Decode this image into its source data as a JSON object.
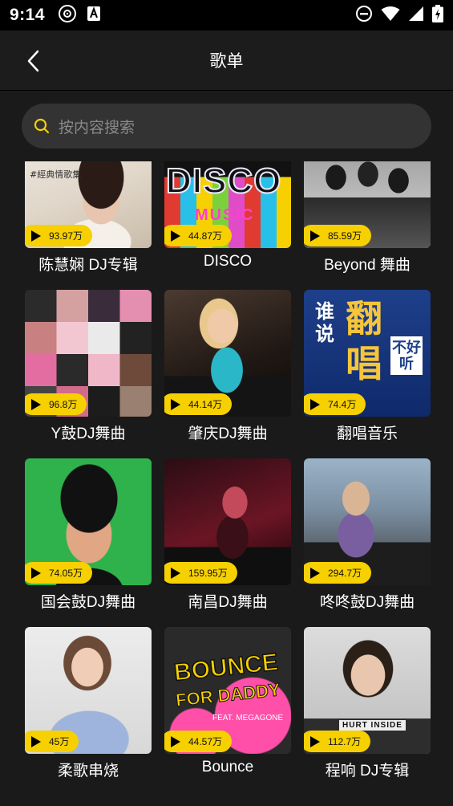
{
  "status_bar": {
    "time": "9:14"
  },
  "header": {
    "title": "歌单"
  },
  "search": {
    "placeholder": "按内容搜索"
  },
  "playlists": [
    {
      "name": "陈慧娴 DJ专辑",
      "plays": "93.97万",
      "art_text": "#經典情歌集"
    },
    {
      "name": "DISCO",
      "plays": "44.87万",
      "art_text": "DISCO",
      "art_text2": "MUSIC"
    },
    {
      "name": "Beyond 舞曲",
      "plays": "85.59万"
    },
    {
      "name": "Y鼓DJ舞曲",
      "plays": "96.8万"
    },
    {
      "name": "肇庆DJ舞曲",
      "plays": "44.14万"
    },
    {
      "name": "翻唱音乐",
      "plays": "74.4万",
      "art_text": "谁说",
      "art_text2": "翻唱",
      "art_text3": "不好听"
    },
    {
      "name": "国会鼓DJ舞曲",
      "plays": "74.05万"
    },
    {
      "name": "南昌DJ舞曲",
      "plays": "159.95万"
    },
    {
      "name": "咚咚鼓DJ舞曲",
      "plays": "294.7万"
    },
    {
      "name": "柔歌串烧",
      "plays": "45万"
    },
    {
      "name": "Bounce",
      "plays": "44.57万",
      "art_text": "BOUNCE",
      "art_text2": "FOR DADDY",
      "art_text3": "FEAT. MEGAGONE"
    },
    {
      "name": "程响 DJ专辑",
      "plays": "112.7万",
      "art_text": "HURT INSIDE"
    }
  ]
}
